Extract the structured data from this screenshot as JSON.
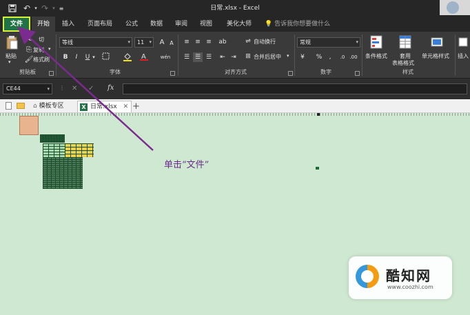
{
  "titlebar": {
    "title": "日常.xlsx - Excel"
  },
  "tabs": [
    {
      "label": "文件",
      "name": "tab-file"
    },
    {
      "label": "开始",
      "name": "tab-home"
    },
    {
      "label": "插入",
      "name": "tab-insert"
    },
    {
      "label": "页面布局",
      "name": "tab-page-layout"
    },
    {
      "label": "公式",
      "name": "tab-formulas"
    },
    {
      "label": "数据",
      "name": "tab-data"
    },
    {
      "label": "审阅",
      "name": "tab-review"
    },
    {
      "label": "视图",
      "name": "tab-view"
    },
    {
      "label": "美化大师",
      "name": "tab-beautify"
    }
  ],
  "tell_me": "告诉我你想要做什么",
  "ribbon": {
    "clipboard": {
      "paste": "粘贴",
      "cut": "切",
      "copy": "复制",
      "format_painter": "格式刷",
      "label": "剪贴板"
    },
    "font": {
      "family": "等线",
      "size": "11",
      "label": "字体",
      "bold": "B",
      "italic": "I",
      "underline": "U",
      "grow": "A",
      "shrink": "A",
      "phonetic": "wén"
    },
    "alignment": {
      "wrap": "自动换行",
      "merge": "合并后居中",
      "label": "对齐方式"
    },
    "number": {
      "format": "常规",
      "label": "数字",
      "percent": "%",
      "comma": ","
    },
    "styles": {
      "conditional": "条件格式",
      "table": "套用",
      "table2": "表格格式",
      "cell": "单元格样式",
      "label": "样式"
    },
    "cells": {
      "insert": "插入"
    }
  },
  "formula_bar": {
    "name_box": "CE44",
    "fx": "fx",
    "cancel": "✕",
    "confirm": "✓"
  },
  "doc_tabs": {
    "template": "模板专区",
    "active": "日常.xlsx",
    "add": "+"
  },
  "annotation": "单击“文件”",
  "watermark": {
    "brand": "酷知网",
    "url": "www.coozhi.com"
  },
  "colors": {
    "file_tab_bg": "#217346",
    "file_tab_highlight": "#d8f23a",
    "arrow": "#7b2a8f",
    "sheet_bg": "#cfe8d1"
  }
}
